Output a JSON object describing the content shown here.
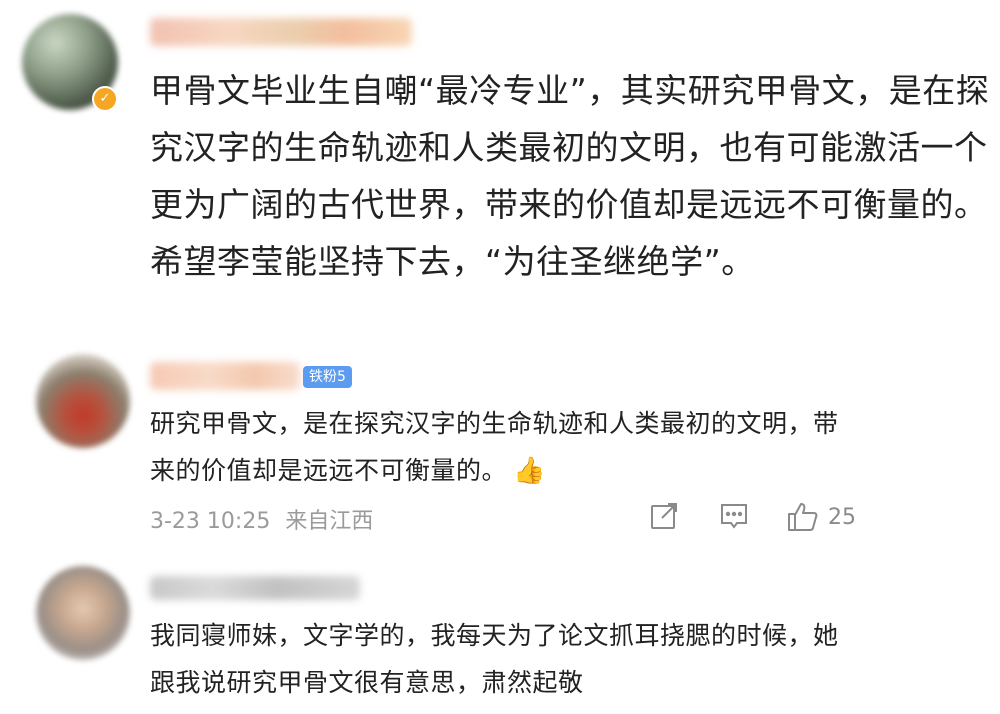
{
  "comments": [
    {
      "text": "甲骨文毕业生自嘲“最冷专业”，其实研究甲骨文，是在探究汉字的生命轨迹和人类最初的文明，也有可能激活一个更为广阔的古代世界，带来的价值却是远远不可衡量的。希望李莹能坚持下去，“为往圣继绝学”。"
    },
    {
      "badge": "铁粉5",
      "text": "研究甲骨文，是在探究汉字的生命轨迹和人类最初的文明，带来的价值却是远远不可衡量的。",
      "emoji": "👍",
      "timestamp": "3-23 10:25",
      "location": "来自江西",
      "likes": "25"
    },
    {
      "text": "我同寝师妹，文字学的，我每天为了论文抓耳挠腮的时候，她跟我说研究甲骨文很有意思，肃然起敬"
    }
  ],
  "icons": {
    "share": "share-icon",
    "comment": "comment-icon",
    "like": "thumbs-up-icon"
  },
  "colors": {
    "fan_badge": "#5b9bf0",
    "verified_badge": "#f5a623",
    "meta_text": "#9a9a9a"
  }
}
